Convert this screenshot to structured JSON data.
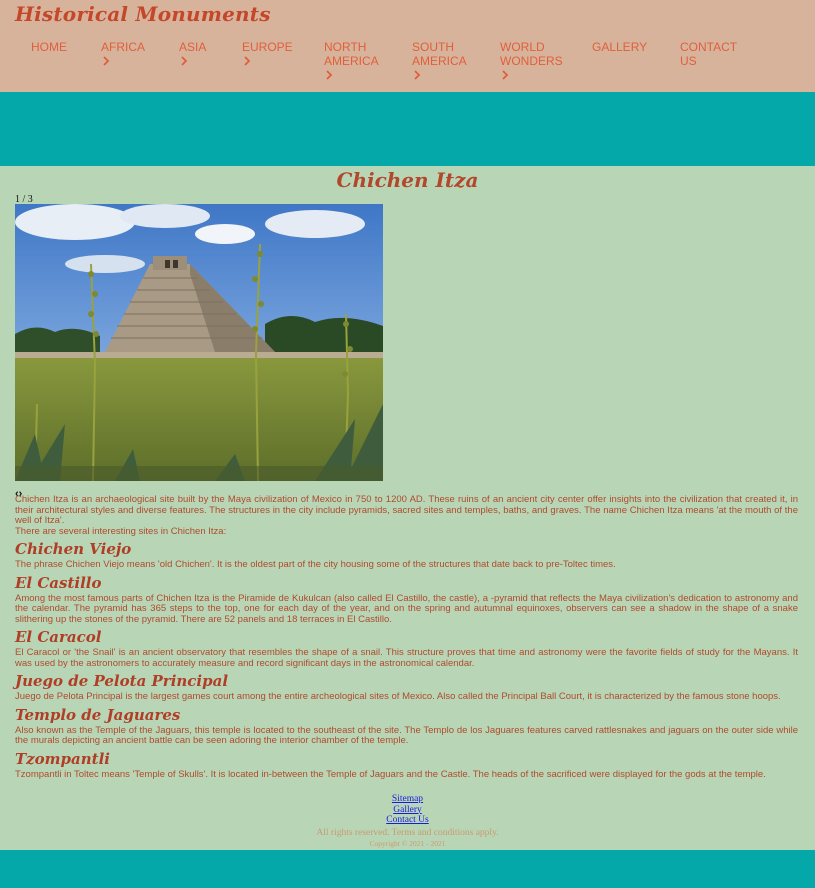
{
  "site_title": "Historical Monuments",
  "nav": [
    {
      "id": "home",
      "lines": [
        "HOME"
      ],
      "dropdown": false
    },
    {
      "id": "africa",
      "lines": [
        "AFRICA"
      ],
      "dropdown": true
    },
    {
      "id": "asia",
      "lines": [
        "ASIA"
      ],
      "dropdown": true
    },
    {
      "id": "europe",
      "lines": [
        "EUROPE"
      ],
      "dropdown": true
    },
    {
      "id": "north-america",
      "lines": [
        "NORTH",
        "AMERICA"
      ],
      "dropdown": true
    },
    {
      "id": "south-america",
      "lines": [
        "SOUTH",
        "AMERICA"
      ],
      "dropdown": true
    },
    {
      "id": "world-wonders",
      "lines": [
        "WORLD",
        "WONDERS"
      ],
      "dropdown": true
    },
    {
      "id": "gallery",
      "lines": [
        "GALLERY"
      ],
      "dropdown": false
    },
    {
      "id": "contact",
      "lines": [
        "CONTACT",
        "US"
      ],
      "dropdown": false
    }
  ],
  "page_title": "Chichen Itza",
  "slideshow": {
    "counter": "1 / 3",
    "prev_icon": "chevron-left-icon",
    "next_icon": "chevron-right-icon"
  },
  "intro": [
    "Chichen Itza is an archaeological site built by the Maya civilization of Mexico in 750 to 1200 AD. These ruins of an ancient city center offer insights into the civilization that created it, in their architectural styles and diverse features. The structures in the city include pyramids, sacred sites and temples, baths, and graves. The name Chichen Itza means 'at the mouth of the well of Itza'.",
    "There are several interesting sites in Chichen Itza:"
  ],
  "sites": [
    {
      "title": "Chichen Viejo",
      "text": "The phrase Chichen Viejo means 'old Chichen'. It is the oldest part of the city housing some of the structures that date back to pre-Toltec times."
    },
    {
      "title": "El Castillo",
      "text": "Among the most famous parts of Chichen Itza is the Piramide de Kukulcan (also called El Castillo, the castle), a -pyramid that reflects the Maya civilization's dedication to astronomy and the calendar. The pyramid has 365 steps to the top, one for each day of the year, and on the spring and autumnal equinoxes, observers can see a shadow in the shape of a snake slithering up the stones of the pyramid. There are 52 panels and 18 terraces in El Castillo."
    },
    {
      "title": "El Caracol",
      "text": "El Caracol or 'the Snail' is an ancient observatory that resembles the shape of a snail. This structure proves that time and astronomy were the favorite fields of study for the Mayans. It was used by the astronomers to accurately measure and record significant days in the astronomical calendar."
    },
    {
      "title": "Juego de Pelota Principal",
      "text": "Juego de Pelota Principal is the largest games court among the entire archeological sites of Mexico. Also called the Principal Ball Court, it is characterized by the famous stone hoops."
    },
    {
      "title": "Templo de Jaguares",
      "text": "Also known as the Temple of the Jaguars, this temple is located to the southeast of the site. The Templo de los Jaguares features carved rattlesnakes and jaguars on the outer side while the murals depicting an ancient battle can be seen adoring the interior chamber of the temple."
    },
    {
      "title": "Tzompantli",
      "text": "Tzompantli in Toltec means 'Temple of Skulls'. It is located in-between the Temple of Jaguars and the Castle. The heads of the sacrificed were displayed for the gods at the temple."
    }
  ],
  "footer": {
    "links": [
      "Sitemap",
      "Gallery",
      "Contact Us"
    ],
    "rights": "All rights reserved. Terms and conditions apply.",
    "copyright": "Copyright © 2021 - 2021"
  },
  "colors": {
    "header_bg": "#d8b39c",
    "nav_text": "#e05f3b",
    "teal": "#05a8a8",
    "page_bg": "#b8d6b6",
    "title": "#b3472b"
  }
}
